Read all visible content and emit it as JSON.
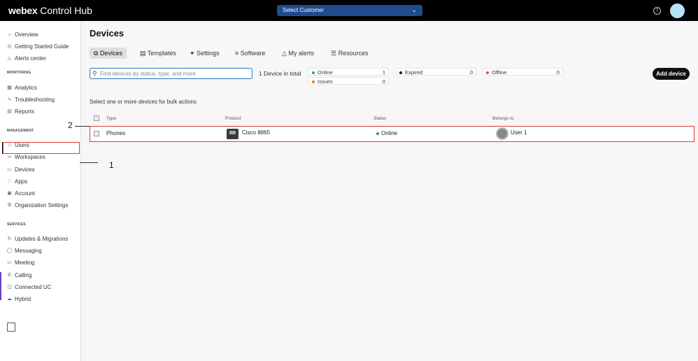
{
  "header": {
    "brand_bold": "webex",
    "brand_rest": " Control Hub",
    "customer_select": "Select Customer",
    "help_icon": "question-circle-icon"
  },
  "sidebar": {
    "top_items": [
      {
        "label": "Overview",
        "icon": "home-icon"
      },
      {
        "label": "Getting Started Guide",
        "icon": "compass-icon"
      },
      {
        "label": "Alerts center",
        "icon": "bell-icon"
      }
    ],
    "monitoring_label": "MONITORING",
    "monitoring_items": [
      {
        "label": "Analytics",
        "icon": "chart-icon"
      },
      {
        "label": "Troubleshooting",
        "icon": "pulse-icon"
      },
      {
        "label": "Reports",
        "icon": "document-icon"
      }
    ],
    "management_label": "MANAGEMENT",
    "management_items": [
      {
        "label": "Users",
        "icon": "user-icon"
      },
      {
        "label": "Workspaces",
        "icon": "workspaces-icon"
      },
      {
        "label": "Devices",
        "icon": "devices-icon"
      },
      {
        "label": "Apps",
        "icon": "apps-icon"
      },
      {
        "label": "Account",
        "icon": "account-icon"
      },
      {
        "label": "Organization Settings",
        "icon": "gear-icon"
      }
    ],
    "services_label": "SERVICES",
    "services_items": [
      {
        "label": "Updates & Migrations",
        "icon": "refresh-icon"
      },
      {
        "label": "Messaging",
        "icon": "chat-icon"
      },
      {
        "label": "Meeting",
        "icon": "meeting-icon"
      },
      {
        "label": "Calling",
        "icon": "phone-icon"
      },
      {
        "label": "Connected UC",
        "icon": "database-icon"
      },
      {
        "label": "Hybrid",
        "icon": "cloud-icon"
      }
    ]
  },
  "main": {
    "title": "Devices",
    "tabs": [
      "Devices",
      "Templates",
      "Settings",
      "Software",
      "My alerts",
      "Resources"
    ],
    "search_placeholder": "Find devices by status, type, and more",
    "total": "1 Device in total",
    "stats": {
      "online_label": "Online",
      "online_count": "1",
      "issues_label": "Issues",
      "issues_count": "0",
      "expired_label": "Expired",
      "expired_count": "0",
      "offline_label": "Offline",
      "offline_count": "0"
    },
    "add_device": "Add device",
    "bulk_text": "Select one or more devices for bulk actions",
    "columns": [
      "Type",
      "Product",
      "Status",
      "Belongs to"
    ],
    "rows": [
      {
        "type": "Phones",
        "product": "Cisco 8865",
        "status": "Online",
        "belongs_to": "User 1"
      }
    ]
  },
  "annotations": {
    "callout_1": "1",
    "callout_2": "2"
  },
  "colors": {
    "highlight": "#e03b2f",
    "online": "#2c9e6a",
    "issues": "#e87c1e",
    "expired": "#111111",
    "offline": "#e8434f",
    "brand_blue": "#1f4b8f"
  }
}
